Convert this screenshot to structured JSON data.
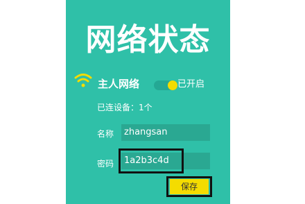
{
  "panel": {
    "background_color": "#2fc0a8"
  },
  "title": "网络状态",
  "main_network": {
    "icon": "wifi-icon",
    "label": "主人网络",
    "toggle_state": "on",
    "toggle_status_label": "已开启"
  },
  "connected_devices_text": "已连设备：1个",
  "form": {
    "name_label": "名称",
    "name_value": "zhangsan",
    "password_label": "密码",
    "password_value": "1a2b3c4d",
    "save_label": "保存"
  },
  "colors": {
    "accent_yellow": "#f4dc00",
    "field_background": "#2aa892",
    "highlight_border": "#111111"
  }
}
